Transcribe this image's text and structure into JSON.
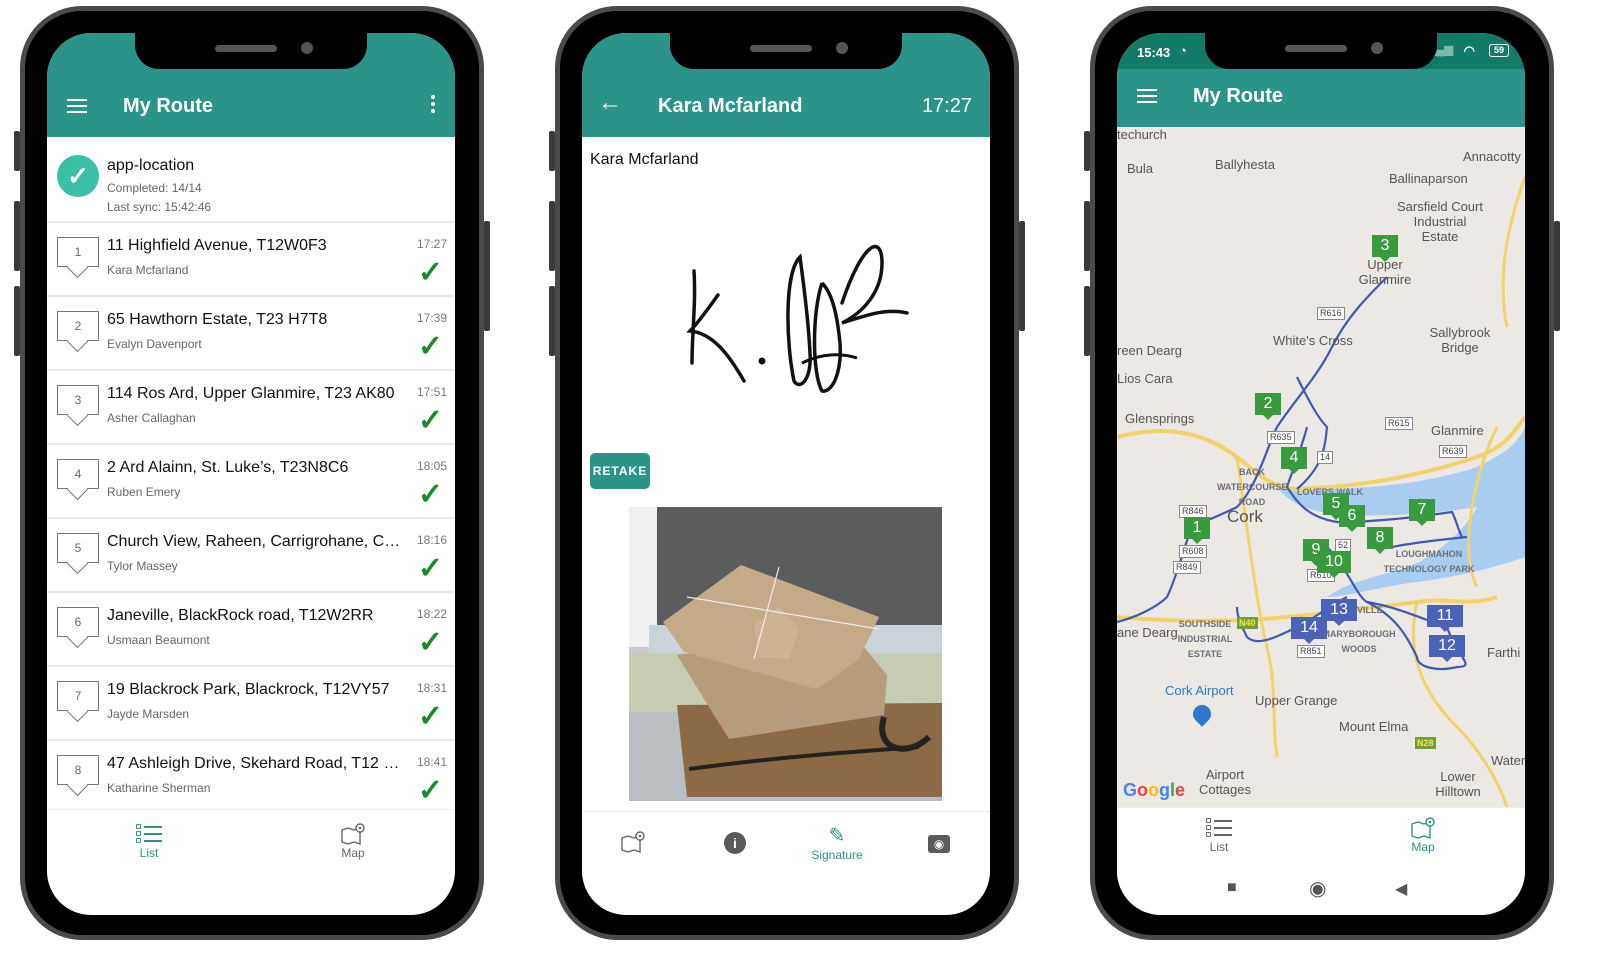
{
  "colors": {
    "primary": "#2b9387",
    "status_bar": "#137a68",
    "success": "#1a8a2a",
    "marker_green": "#3a9a3e",
    "marker_blue": "#4a62b8"
  },
  "phone1": {
    "appbar": {
      "title": "My Route",
      "menu_icon": "hamburger-icon",
      "overflow_icon": "more-vertical-icon"
    },
    "summary": {
      "name": "app-location",
      "completed": "Completed: 14/14",
      "last_sync": "Last sync: 15:42:46",
      "icon": "check-circle-icon"
    },
    "stops": [
      {
        "n": "1",
        "address": "11 Highfield Avenue, T12W0F3",
        "customer": "Kara Mcfarland",
        "time": "17:27",
        "status_icon": "✓"
      },
      {
        "n": "2",
        "address": "65 Hawthorn Estate, T23 H7T8",
        "customer": "Evalyn Davenport",
        "time": "17:39",
        "status_icon": "✓"
      },
      {
        "n": "3",
        "address": "114 Ros Ard, Upper Glanmire, T23 AK80",
        "customer": "Asher Callaghan",
        "time": "17:51",
        "status_icon": "✓"
      },
      {
        "n": "4",
        "address": "2 Ard Alainn, St. Luke’s, T23N8C6",
        "customer": "Ruben Emery",
        "time": "18:05",
        "status_icon": "✓"
      },
      {
        "n": "5",
        "address": "Church View, Raheen, Carrigrohane, Co…",
        "customer": "Tylor Massey",
        "time": "18:16",
        "status_icon": "✓"
      },
      {
        "n": "6",
        "address": "Janeville, BlackRock road, T12W2RR",
        "customer": "Usmaan Beaumont",
        "time": "18:22",
        "status_icon": "✓"
      },
      {
        "n": "7",
        "address": "19 Blackrock Park, Blackrock, T12VY57",
        "customer": "Jayde Marsden",
        "time": "18:31",
        "status_icon": "✓"
      },
      {
        "n": "8",
        "address": "47 Ashleigh Drive, Skehard Road, T12 X…",
        "customer": "Katharine Sherman",
        "time": "18:41",
        "status_icon": "✓"
      }
    ],
    "bottom_nav": [
      {
        "label": "List",
        "icon": "list-icon",
        "active": true
      },
      {
        "label": "Map",
        "icon": "map-pin-icon",
        "active": false
      }
    ]
  },
  "phone2": {
    "appbar": {
      "title": "Kara Mcfarland",
      "time": "17:27",
      "back_icon": "←"
    },
    "recipient_name": "Kara Mcfarland",
    "signature_alt": "Customer signature",
    "retake_label": "RETAKE",
    "photo_alt": "Delivered parcels on doormat",
    "bottom_nav": [
      {
        "label": "",
        "icon": "map-pin-icon",
        "active": false
      },
      {
        "label": "",
        "icon": "info-icon",
        "glyph": "i",
        "active": false
      },
      {
        "label": "Signature",
        "icon": "pencil-icon",
        "glyph": "✎",
        "active": true
      },
      {
        "label": "",
        "icon": "camera-icon",
        "glyph": "◉",
        "active": false
      }
    ]
  },
  "phone3": {
    "status_bar": {
      "time": "15:43",
      "battery": "59",
      "app_icons": "◔",
      "wifi": "◠",
      "signal": "▂▄▆"
    },
    "appbar": {
      "title": "My Route"
    },
    "map": {
      "place_labels": [
        "techurch",
        "Bula",
        "Ballyhesta",
        "Annacotty",
        "Ballinaparson",
        "Sarsfield Court Industrial Estate",
        "Upper Glanmire",
        "White's Cross",
        "Sallybrook Bridge",
        "reen Dearg",
        "Lios Cara",
        "Glensprings",
        "Glanmire",
        "BACK WATERCOURSE ROAD",
        "LOVERS WALK",
        "Cork",
        "LOUGHMAHON TECHNOLOGY PARK",
        "SOUTHSIDE INDUSTRIAL ESTATE",
        "ane Dearg",
        "MARYBOROUGH WOODS",
        "VILLE",
        "Farthi",
        "Cork Airport",
        "Upper Grange",
        "Mount Elma",
        "Airport Cottages",
        "Lower Hilltown",
        "Water"
      ],
      "road_shields": [
        "R616",
        "R635",
        "R615",
        "R639",
        "R846",
        "R608",
        "R849",
        "R610",
        "R851",
        "14",
        "52"
      ],
      "national_shields": [
        "N40",
        "N28"
      ],
      "markers_completed_green": [
        "1",
        "2",
        "3",
        "4",
        "5",
        "6",
        "7",
        "8",
        "9",
        "10"
      ],
      "markers_blue": [
        "11",
        "12",
        "13",
        "14"
      ],
      "attribution": "Google"
    },
    "bottom_nav": [
      {
        "label": "List",
        "icon": "list-icon",
        "active": false
      },
      {
        "label": "Map",
        "icon": "map-pin-icon",
        "active": true
      }
    ],
    "system_nav": {
      "recents": "■",
      "home": "◉",
      "back": "◀"
    }
  }
}
